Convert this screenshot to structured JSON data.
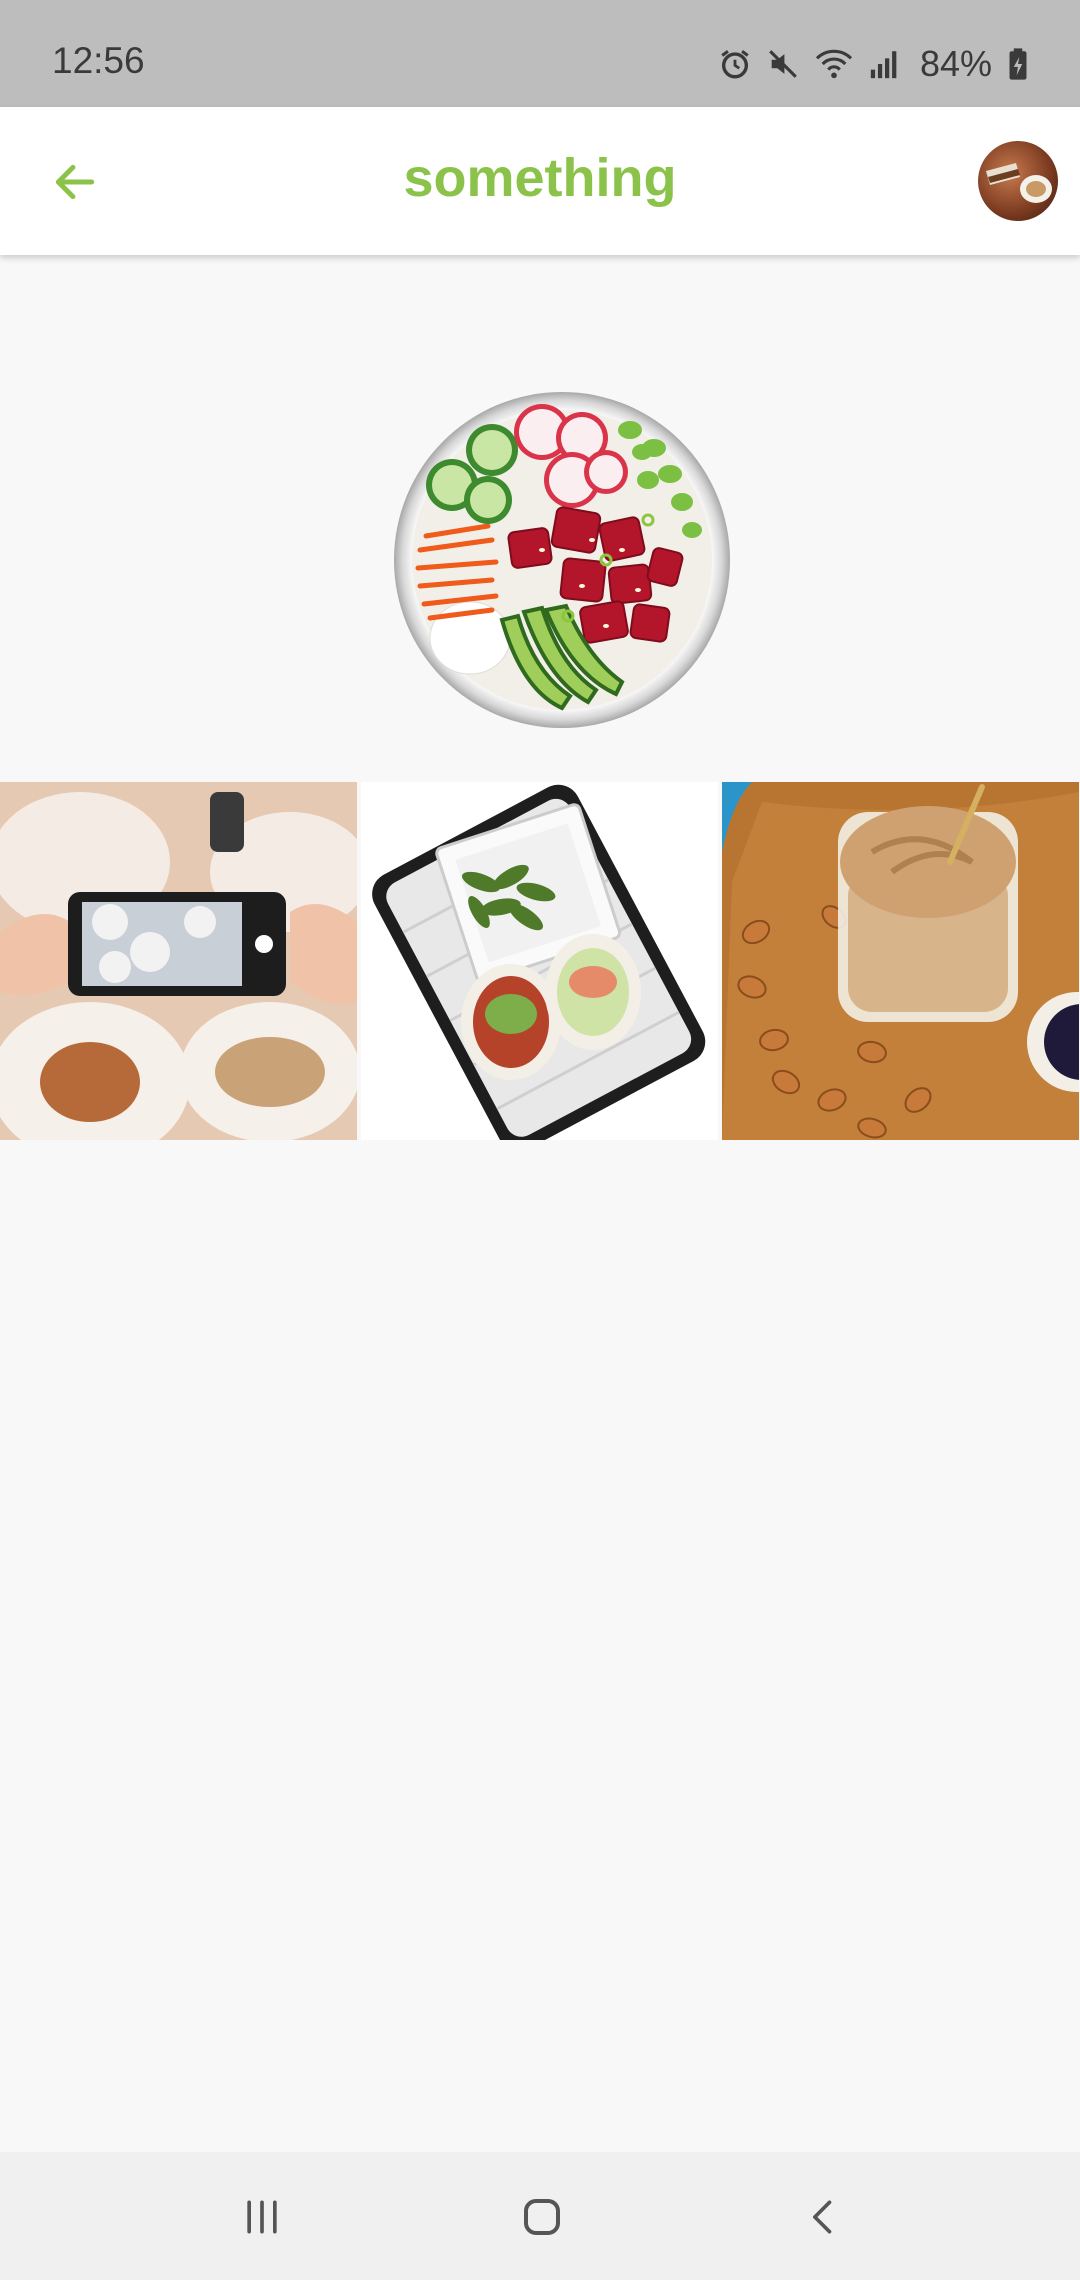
{
  "status_bar": {
    "time": "12:56",
    "battery": "84%",
    "icons": [
      "alarm-icon",
      "mute-icon",
      "wifi-icon",
      "signal-icon",
      "battery-icon"
    ]
  },
  "app_bar": {
    "title": "something",
    "back_icon": "arrow-left-icon",
    "accent_color": "#8bc34a"
  },
  "hero": {
    "image": "poke-bowl-image"
  },
  "gallery": {
    "tiles": [
      {
        "image": "phone-photographing-food-image"
      },
      {
        "image": "edamame-and-bao-tray-image"
      },
      {
        "image": "almond-butter-jar-image"
      }
    ]
  },
  "nav_bar": {
    "buttons": [
      "recents-icon",
      "home-icon",
      "back-icon"
    ]
  }
}
